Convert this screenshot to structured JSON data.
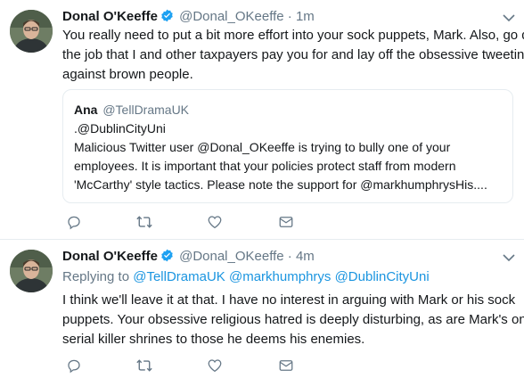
{
  "tweets": [
    {
      "name": "Donal O'Keeffe",
      "handle": "@Donal_OKeeffe",
      "separator": "·",
      "time": "1m",
      "lines": [
        "You really need to put a bit more effort into your sock puppets, Mark. Also, go do",
        "the job that I and other taxpayers pay you for and lay off the obsessive tweeting",
        "against brown people."
      ],
      "quote": {
        "name": "Ana",
        "handle": "@TellDramaUK",
        "lines": [
          ".@DublinCityUni",
          "Malicious Twitter user @Donal_OKeeffe is trying to bully one of your",
          "employees. It is important that your policies protect staff from modern",
          "'McCarthy' style tactics. Please note the support for @markhumphrysHis...."
        ]
      }
    },
    {
      "name": "Donal O'Keeffe",
      "handle": "@Donal_OKeeffe",
      "separator": "·",
      "time": "4m",
      "replying_label": "Replying to",
      "replying_to": [
        "@TellDramaUK",
        "@markhumphrys",
        "@DublinCityUni"
      ],
      "lines": [
        "I think we'll leave it at that. I have no interest in arguing with Mark or his sock",
        "puppets. Your obsessive religious hatred is deeply disturbing, as are Mark's online",
        "serial killer shrines to those he deems his enemies."
      ]
    }
  ],
  "colors": {
    "link": "#1b95e0",
    "verified": "#1da1f2",
    "muted": "#657786",
    "border": "#e6ecf0",
    "action_icon": "#657786"
  },
  "icons": [
    "verified-badge-icon",
    "chevron-down-icon",
    "reply-icon",
    "retweet-icon",
    "like-icon",
    "direct-message-icon"
  ]
}
